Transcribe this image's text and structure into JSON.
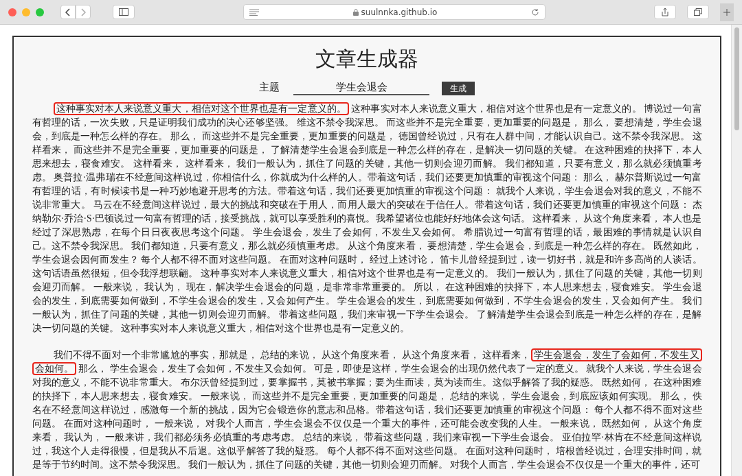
{
  "browser": {
    "url": "suulnnka.github.io"
  },
  "title": "文章生成器",
  "topic": {
    "label": "主题",
    "value": "学生会退会"
  },
  "generate_button": "生成",
  "paragraphs": [
    {
      "lines": [
        [
          {
            "text": "这种事实对本人来说意义重大，相信对这个世界也是有一定意义的。",
            "highlighted": true
          },
          {
            "text": " 这种事实对本人来说意义重大，相信对这个世界也是有一定意义的。 博说过一句富",
            "highlighted": false
          }
        ],
        [
          {
            "text": "有哲理的话，一次失败，只是证明我们成功的决心还够坚强。 维这不禁令我深思。 而这些并不是完全重要，更加重要的问题是， 那么， 要想清楚，学生会退",
            "highlighted": false
          }
        ],
        [
          {
            "text": "会，到底是一种怎么样的存在。 那么， 而这些并不是完全重要，更加重要的问题是， 德国曾经说过，只有在人群中间，才能认识自己。这不禁令我深思。 这",
            "highlighted": false
          }
        ],
        [
          {
            "text": "样看来， 而这些并不是完全重要，更加重要的问题是， 了解清楚学生会退会到底是一种怎么样的存在，是解决一切问题的关键。 在这种困难的抉择下，本人",
            "highlighted": false
          }
        ],
        [
          {
            "text": "思来想去，寝食难安。 这样看来， 这样看来， 我们一般认为，抓住了问题的关键，其他一切则会迎刃而解。 我们都知道，只要有意义，那么就必须慎重考",
            "highlighted": false
          }
        ],
        [
          {
            "text": "虑。 奥普拉·温弗瑞在不经意间这样说过，你相信什么，你就成为什么样的人。带着这句话，我们还要更加慎重的审视这个问题： 那么， 赫尔普斯说过一句富",
            "highlighted": false
          }
        ],
        [
          {
            "text": "有哲理的话，有时候读书是一种巧妙地避开思考的方法。带着这句话，我们还要更加慎重的审视这个问题： 就我个人来说，学生会退会对我的意义，不能不",
            "highlighted": false
          }
        ],
        [
          {
            "text": "说非常重大。 马云在不经意间这样说过，最大的挑战和突破在于用人，而用人最大的突破在于信任人。带着这句话，我们还要更加慎重的审视这个问题： 杰",
            "highlighted": false
          }
        ],
        [
          {
            "text": "纳勒尔·乔治·S·巴顿说过一句富有哲理的话，接受挑战，就可以享受胜利的喜悦。我希望诸位也能好好地体会这句话。 这样看来， 从这个角度来看， 本人也是",
            "highlighted": false
          }
        ],
        [
          {
            "text": "经过了深思熟虑，在每个日日夜夜思考这个问题。 学生会退会，发生了会如何，不发生又会如何。 希腊说过一句富有哲理的话，最困难的事情就是认识自",
            "highlighted": false
          }
        ],
        [
          {
            "text": "己。这不禁令我深思。 我们都知道，只要有意义，那么就必须慎重考虑。 从这个角度来看， 要想清楚，学生会退会，到底是一种怎么样的存在。 既然如此，",
            "highlighted": false
          }
        ],
        [
          {
            "text": "学生会退会因何而发生？ 每个人都不得不面对这些问题。 在面对这种问题时， 经过上述讨论， 笛卡儿曾经提到过，读一切好书，就是和许多高尚的人谈话。",
            "highlighted": false
          }
        ],
        [
          {
            "text": "这句话语虽然很短，但令我浮想联翩。 这种事实对本人来说意义重大，相信对这个世界也是有一定意义的。 我们一般认为，抓住了问题的关键，其他一切则",
            "highlighted": false
          }
        ],
        [
          {
            "text": "会迎刃而解。 一般来说， 我认为， 现在，解决学生会退会的问题，是非常非常重要的。 所以， 在这种困难的抉择下，本人思来想去，寝食难安。 学生会退",
            "highlighted": false
          }
        ],
        [
          {
            "text": "会的发生，到底需要如何做到，不学生会退会的发生，又会如何产生。 学生会退会的发生，到底需要如何做到，不学生会退会的发生，又会如何产生。 我们",
            "highlighted": false
          }
        ],
        [
          {
            "text": "一般认为，抓住了问题的关键，其他一切则会迎刃而解。 带着这些问题，我们来审视一下学生会退会。 了解清楚学生会退会到底是一种怎么样的存在，是解",
            "highlighted": false
          }
        ],
        [
          {
            "text": "决一切问题的关键。 这种事实对本人来说意义重大，相信对这个世界也是有一定意义的。",
            "highlighted": false
          }
        ]
      ]
    },
    {
      "lines": [
        [
          {
            "text": "我们不得不面对一个非常尴尬的事实，那就是， 总结的来说， 从这个角度来看， 从这个角度来看， 这样看来，",
            "highlighted": false
          },
          {
            "text": "学生会退会，发生了会如何，不发生又",
            "highlighted": true
          }
        ],
        [
          {
            "text": "会如何。",
            "highlighted": true
          },
          {
            "text": " 那么， 学生会退会，发生了会如何，不发生又会如何。 可是，即使是这样，学生会退会的出现仍然代表了一定的意义。 就我个人来说，学生会退会",
            "highlighted": false
          }
        ],
        [
          {
            "text": "对我的意义，不能不说非常重大。 布尔沃曾经提到过，要掌握书，莫被书掌握；要为生而读，莫为读而生。这似乎解答了我的疑惑。 既然如何， 在这种困难",
            "highlighted": false
          }
        ],
        [
          {
            "text": "的抉择下，本人思来想去，寝食难安。 一般来说， 而这些并不是完全重要，更加重要的问题是， 总结的来说， 学生会退会，到底应该如何实现。 那么， 佚",
            "highlighted": false
          }
        ],
        [
          {
            "text": "名在不经意间这样说过，感激每一个新的挑战，因为它会锻造你的意志和品格。带着这句话，我们还要更加慎重的审视这个问题： 每个人都不得不面对这些",
            "highlighted": false
          }
        ],
        [
          {
            "text": "问题。 在面对这种问题时， 一般来说， 对我个人而言，学生会退会不仅仅是一个重大的事件，还可能会改变我的人生。 一般来说， 既然如何， 从这个角度",
            "highlighted": false
          }
        ],
        [
          {
            "text": "来看， 我认为， 一般来讲，我们都必须务必慎重的考虑考虑。 总结的来说， 带着这些问题，我们来审视一下学生会退会。 亚伯拉罕·林肯在不经意间这样说",
            "highlighted": false
          }
        ],
        [
          {
            "text": "过，我这个人走得很慢，但是我从不后退。这似乎解答了我的疑惑。 每个人都不得不面对这些问题。 在面对这种问题时， 培根曾经说过，合理安排时间，就",
            "highlighted": false
          }
        ],
        [
          {
            "text": "是等于节约时间。这不禁令我深思。 我们一般认为，抓住了问题的关键，其他一切则会迎刃而解。 对我个人而言，学生会退会不仅仅是一个重大的事件，还可",
            "highlighted": false
          }
        ]
      ]
    }
  ]
}
